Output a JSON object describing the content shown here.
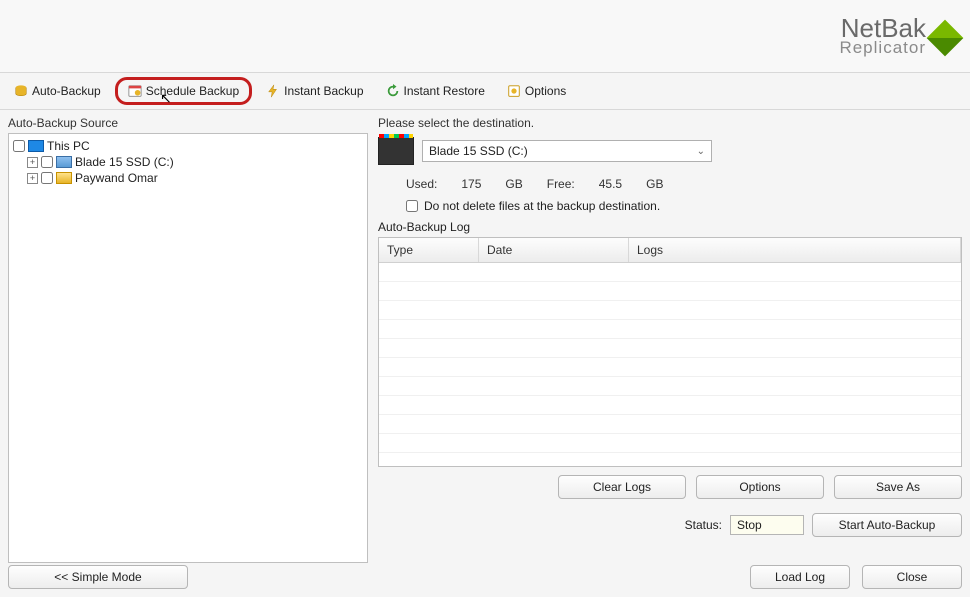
{
  "app": {
    "name": "NetBak",
    "subtitle": "Replicator"
  },
  "toolbar": {
    "auto_backup": "Auto-Backup",
    "schedule_backup": "Schedule Backup",
    "instant_backup": "Instant Backup",
    "instant_restore": "Instant Restore",
    "options": "Options"
  },
  "source": {
    "label": "Auto-Backup Source",
    "root": "This PC",
    "children": [
      {
        "label": "Blade 15 SSD (C:)",
        "icon": "drive"
      },
      {
        "label": "Paywand Omar",
        "icon": "folder"
      }
    ]
  },
  "destination": {
    "prompt": "Please select the destination.",
    "selected": "Blade 15 SSD (C:)",
    "usage": {
      "used_label": "Used:",
      "used_value": "175",
      "used_unit": "GB",
      "free_label": "Free:",
      "free_value": "45.5",
      "free_unit": "GB"
    },
    "do_not_delete": "Do not delete files at the backup destination."
  },
  "log": {
    "label": "Auto-Backup Log",
    "columns": {
      "type": "Type",
      "date": "Date",
      "logs": "Logs"
    }
  },
  "buttons": {
    "clear_logs": "Clear Logs",
    "options": "Options",
    "save_as": "Save As",
    "start": "Start Auto-Backup",
    "simple_mode": "<< Simple Mode",
    "load_log": "Load Log",
    "close": "Close"
  },
  "status": {
    "label": "Status:",
    "value": "Stop"
  }
}
